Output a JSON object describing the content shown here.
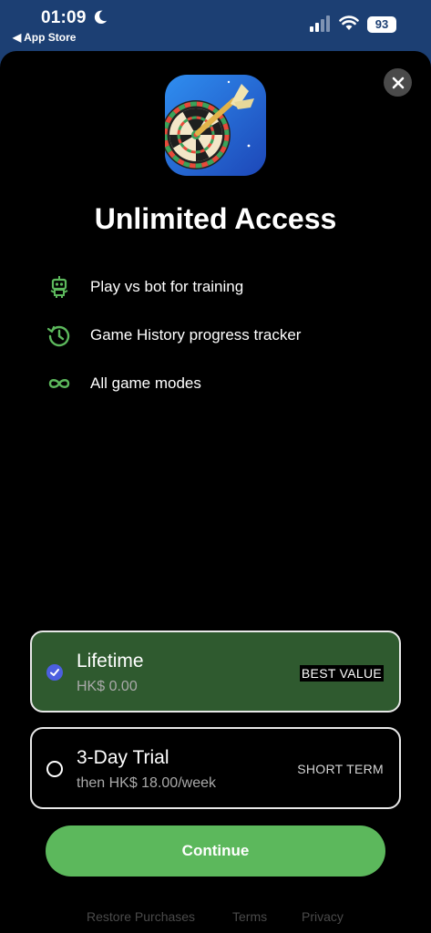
{
  "status": {
    "time": "01:09",
    "back_label": "◀ App Store",
    "battery": "93"
  },
  "paywall": {
    "title": "Unlimited Access",
    "features": [
      {
        "icon": "robot-icon",
        "label": "Play vs bot for training"
      },
      {
        "icon": "history-icon",
        "label": "Game History progress tracker"
      },
      {
        "icon": "infinity-icon",
        "label": "All game modes"
      }
    ],
    "plans": [
      {
        "name": "Lifetime",
        "price": "HK$ 0.00",
        "tag": "BEST VALUE",
        "selected": true
      },
      {
        "name": "3-Day Trial",
        "price": "then HK$ 18.00/week",
        "tag": "SHORT TERM",
        "selected": false
      }
    ],
    "continue_label": "Continue",
    "footer": {
      "restore": "Restore Purchases",
      "terms": "Terms",
      "privacy": "Privacy"
    }
  },
  "colors": {
    "status_bar_bg": "#1c3f73",
    "sheet_bg": "#000000",
    "accent_green": "#5cb85c",
    "selected_plan_bg": "#2f5a2f",
    "checkbox_blue": "#4c5fe0"
  }
}
